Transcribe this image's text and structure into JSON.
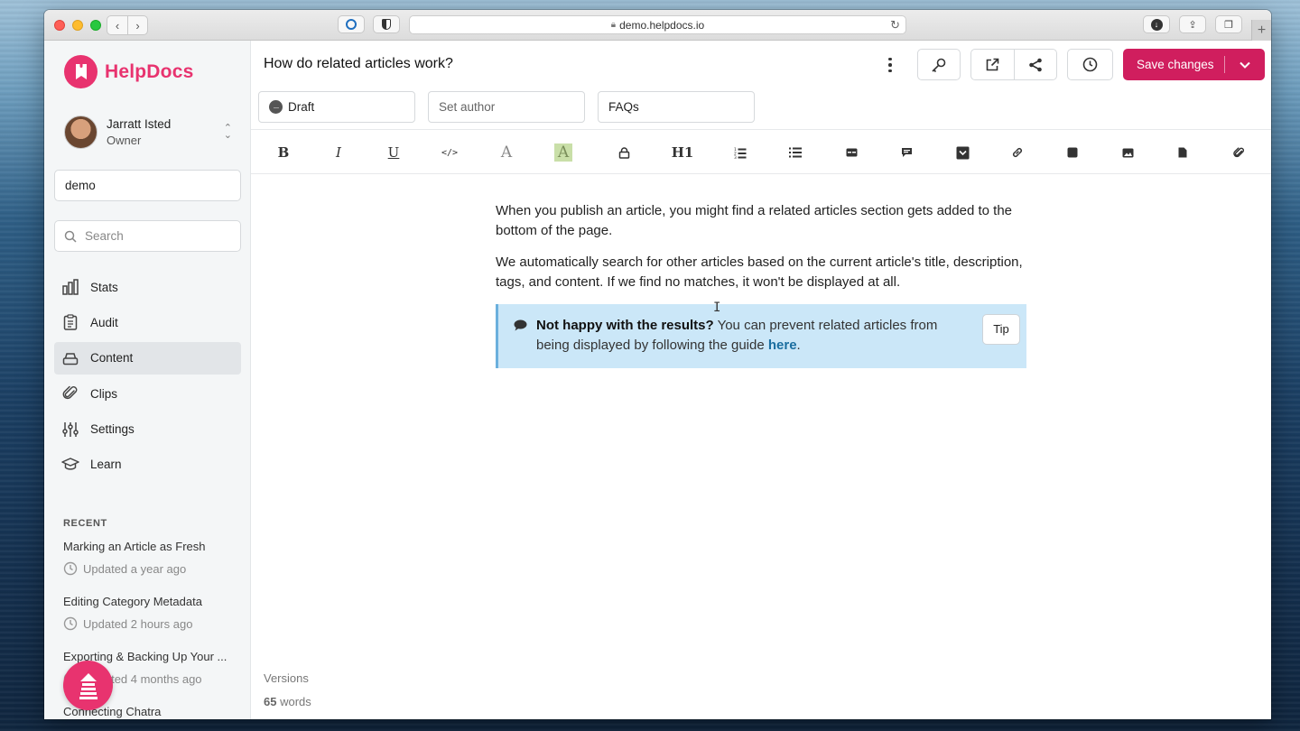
{
  "browser": {
    "url": "demo.helpdocs.io"
  },
  "brand": {
    "name": "HelpDocs",
    "color": "#e8336f"
  },
  "user": {
    "name": "Jarratt Isted",
    "role": "Owner"
  },
  "sidebar": {
    "team": "demo",
    "search_placeholder": "Search",
    "nav": [
      {
        "label": "Stats",
        "icon": "bar-chart-icon"
      },
      {
        "label": "Audit",
        "icon": "clipboard-icon"
      },
      {
        "label": "Content",
        "icon": "stack-icon",
        "active": true
      },
      {
        "label": "Clips",
        "icon": "paperclip-icon"
      },
      {
        "label": "Settings",
        "icon": "sliders-icon"
      },
      {
        "label": "Learn",
        "icon": "graduation-cap-icon"
      }
    ],
    "recent_title": "RECENT",
    "recent": [
      {
        "title": "Marking an Article as Fresh",
        "meta": "Updated a year ago"
      },
      {
        "title": "Editing Category Metadata",
        "meta": "Updated 2 hours ago"
      },
      {
        "title": "Exporting & Backing Up Your ...",
        "meta": "Updated 4 months ago"
      },
      {
        "title": "Connecting Chatra",
        "meta": ""
      }
    ]
  },
  "editor": {
    "title": "How do related articles work?",
    "save_label": "Save changes",
    "status": "Draft",
    "author_placeholder": "Set author",
    "category": "FAQs",
    "paragraphs": [
      "When you publish an article, you might find a related articles section gets added to the bottom of the page.",
      "We automatically search for other articles based on the current article's title, description, tags, and content. If we find no matches, it won't be displayed at all."
    ],
    "callout": {
      "bold": "Not happy with the results?",
      "text": " You can prevent related articles from being displayed by following the guide ",
      "link": "here",
      "end": ".",
      "tag": "Tip"
    },
    "versions_label": "Versions",
    "word_count": "65",
    "word_suffix": " words"
  },
  "toolbar": {
    "tools": [
      "bold",
      "italic",
      "underline",
      "code",
      "font-color",
      "highlight",
      "lock",
      "heading-1",
      "ordered-list",
      "bullet-list",
      "table",
      "comment",
      "accordion",
      "link",
      "embed",
      "image",
      "file",
      "attachment"
    ],
    "glyphs": {
      "bold": "B",
      "italic": "I",
      "underline": "U",
      "code": "</>",
      "font": "A",
      "highlight": "A",
      "h1": "H1"
    }
  }
}
